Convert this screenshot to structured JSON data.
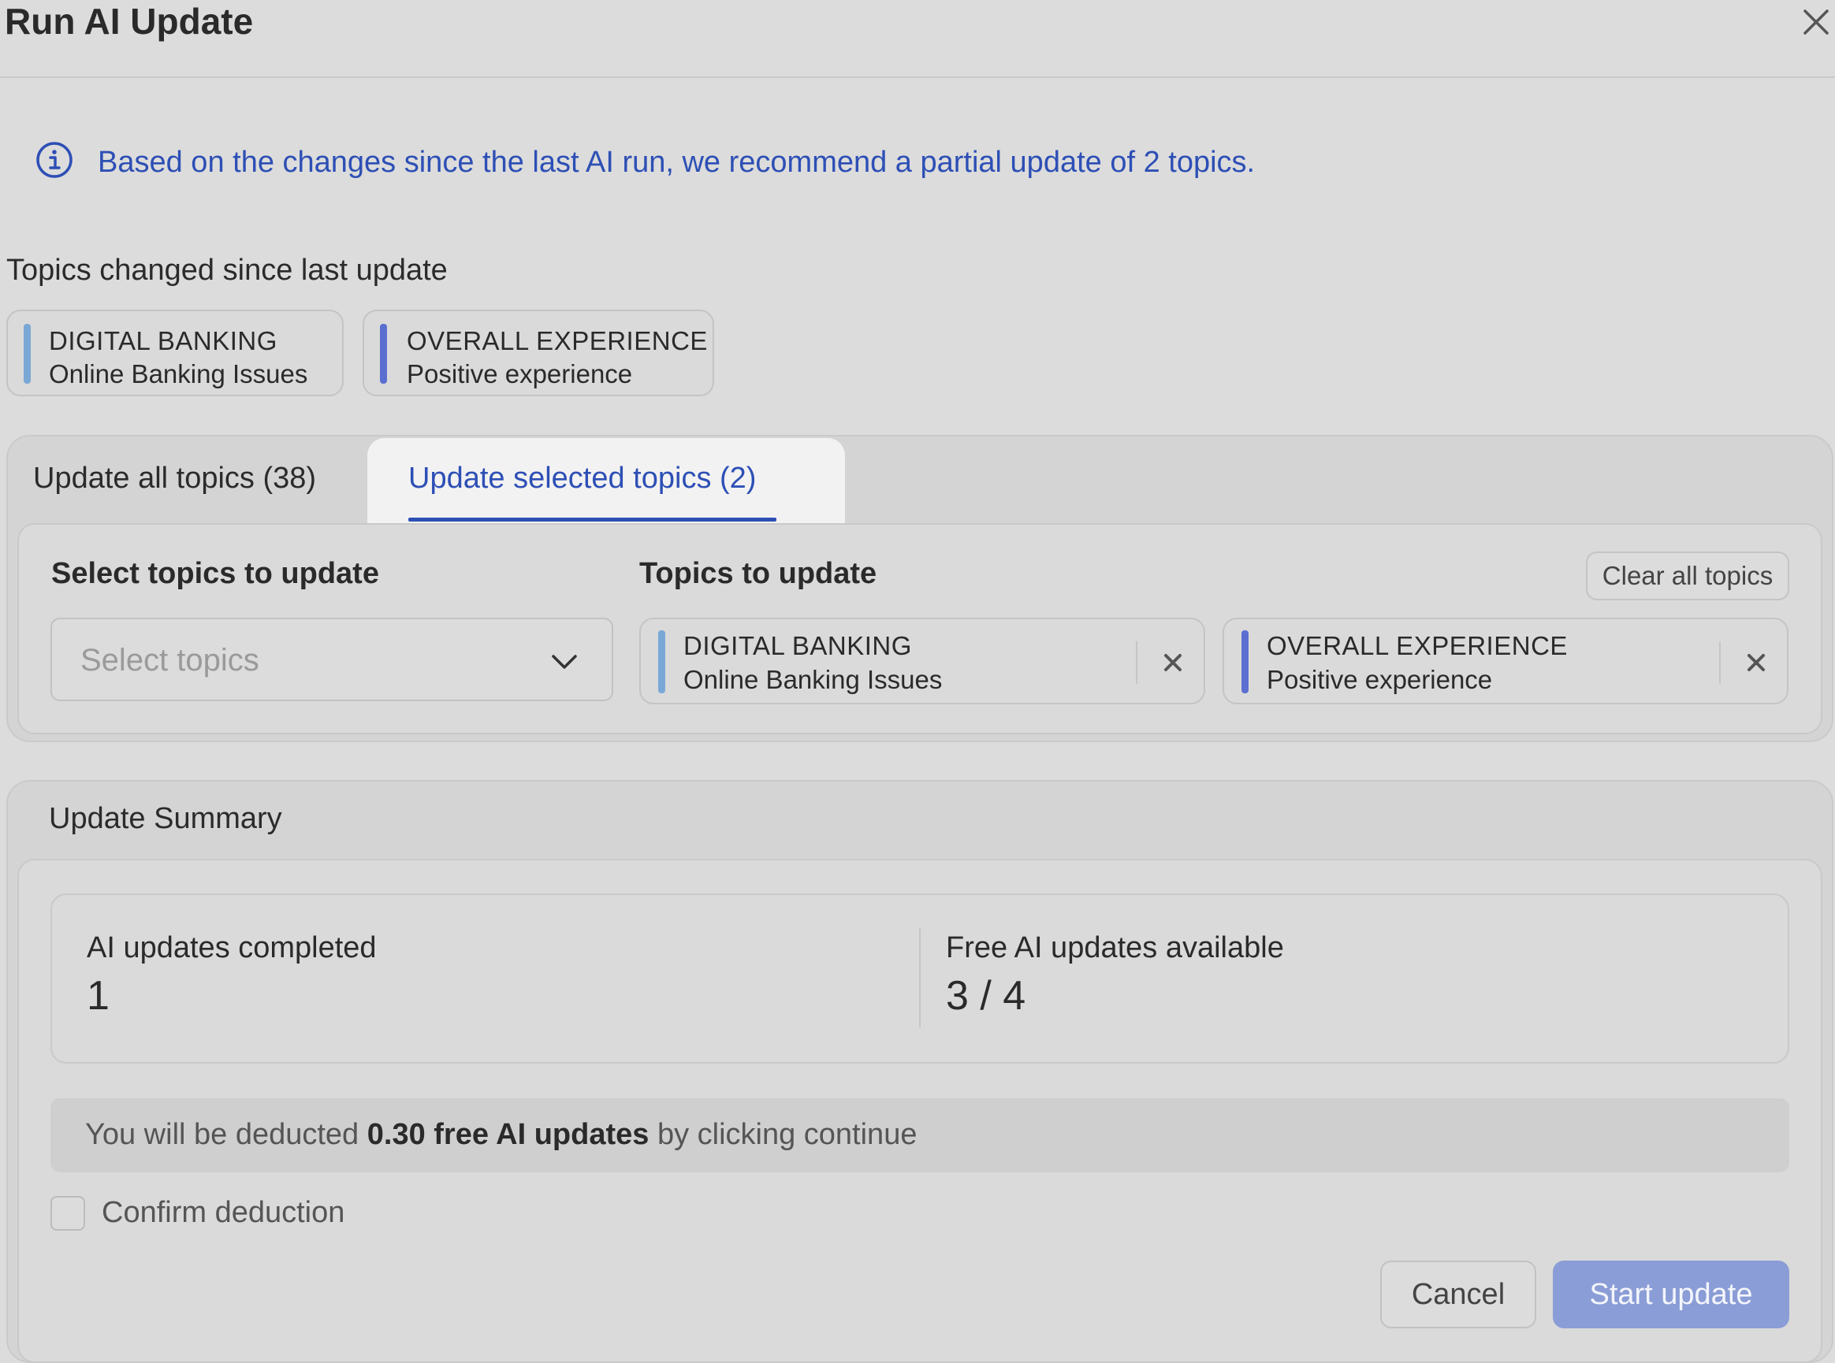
{
  "dialog": {
    "title": "Run AI Update",
    "close_icon": "close-icon"
  },
  "info": {
    "icon": "info-icon",
    "text": "Based on the changes since the last AI run, we recommend a partial update of 2 topics."
  },
  "changed_topics": {
    "label": "Topics changed since last update",
    "items": [
      {
        "category": "DIGITAL BANKING",
        "topic": "Online Banking Issues",
        "color": "#7aa8d6"
      },
      {
        "category": "OVERALL EXPERIENCE",
        "topic": "Positive experience",
        "color": "#5a6fd0"
      }
    ]
  },
  "tabs": {
    "items": [
      {
        "label": "Update all topics (38)",
        "active": false
      },
      {
        "label": "Update selected topics (2)",
        "active": true
      }
    ],
    "active_color": "#2d4fb5"
  },
  "selection": {
    "select_heading": "Select topics to update",
    "select_placeholder": "Select topics",
    "topics_heading": "Topics to update",
    "clear_all_label": "Clear all topics",
    "selected": [
      {
        "category": "DIGITAL BANKING",
        "topic": "Online Banking Issues",
        "color": "#7aa8d6"
      },
      {
        "category": "OVERALL EXPERIENCE",
        "topic": "Positive experience",
        "color": "#5a6fd0"
      }
    ]
  },
  "summary": {
    "title": "Update Summary",
    "completed_label": "AI updates completed",
    "completed_value": "1",
    "free_label": "Free AI updates available",
    "free_value": "3 / 4",
    "deduct_prefix": "You will be deducted ",
    "deduct_amount": "0.30 free AI updates",
    "deduct_suffix": " by clicking continue",
    "confirm_label": "Confirm deduction",
    "confirm_checked": false
  },
  "actions": {
    "cancel_label": "Cancel",
    "start_label": "Start update",
    "start_color": "#8b9dd6"
  }
}
